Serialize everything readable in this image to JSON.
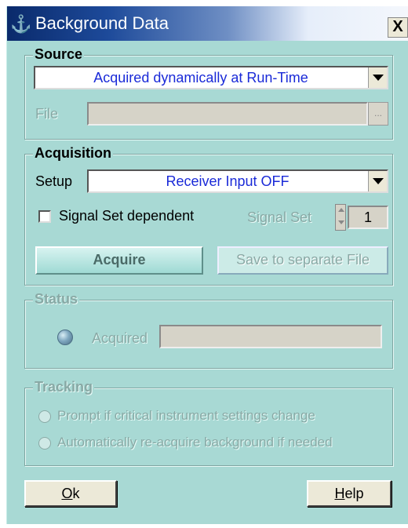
{
  "window": {
    "title": "Background Data",
    "close_label": "X"
  },
  "source": {
    "title": "Source",
    "selected": "Acquired dynamically at Run-Time",
    "file_label": "File",
    "file_value": "",
    "browse_label": "..."
  },
  "acquisition": {
    "title": "Acquisition",
    "setup_label": "Setup",
    "setup_selected": "Receiver Input OFF",
    "signal_set_dependent_label": "Signal Set dependent",
    "signal_set_dependent_checked": false,
    "signal_set_label": "Signal Set",
    "signal_set_value": "1",
    "acquire_label": "Acquire",
    "save_label": "Save to separate File"
  },
  "status": {
    "title": "Status",
    "acquired_label": "Acquired",
    "acquired_value": ""
  },
  "tracking": {
    "title": "Tracking",
    "option1": "Prompt if critical instrument settings change",
    "option2": "Automatically re-acquire background if needed"
  },
  "buttons": {
    "ok_rest": "k",
    "ok_mnemonic": "O",
    "help_rest": "elp",
    "help_mnemonic": "H"
  }
}
